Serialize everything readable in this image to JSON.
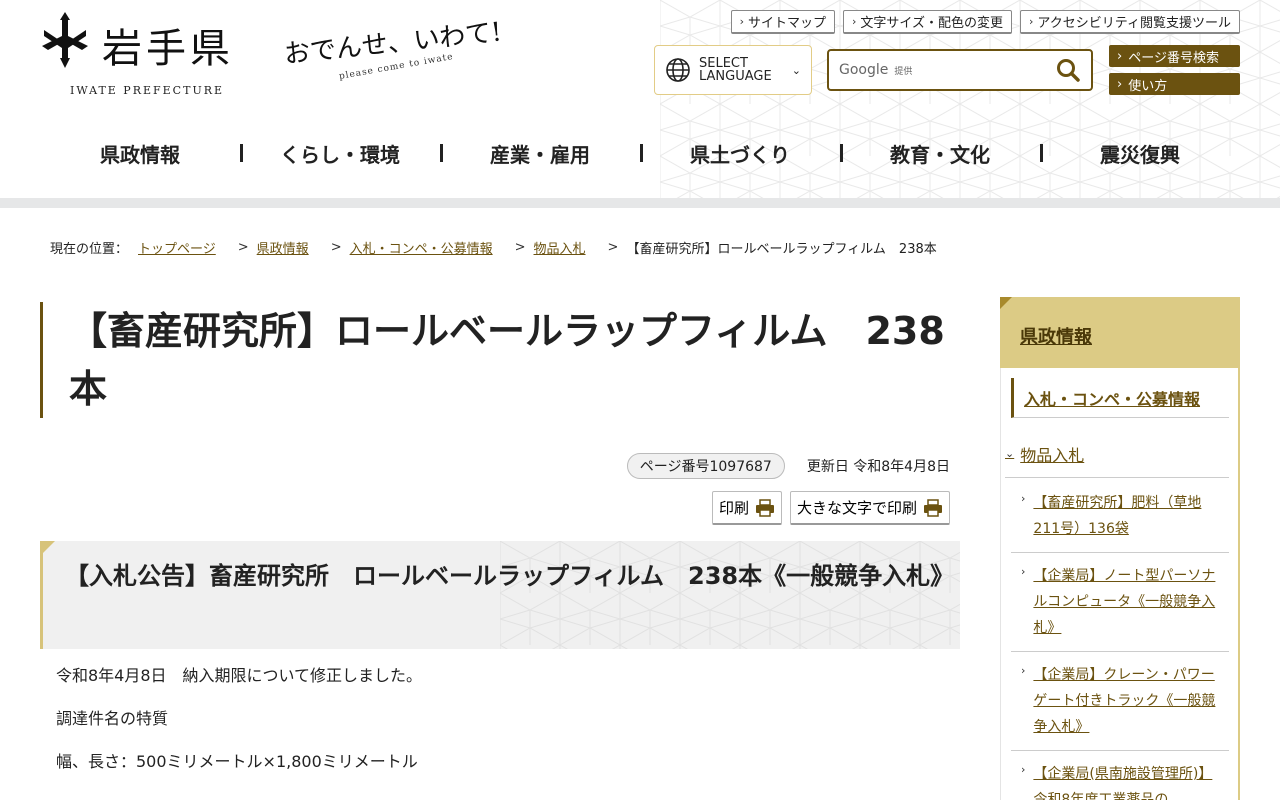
{
  "header": {
    "logo_name": "岩手県",
    "logo_sub": "IWATE PREFECTURE",
    "catch_main": "おでんせ、いわて!",
    "catch_sub": "please come to iwate",
    "util_links": [
      "サイトマップ",
      "文字サイズ・配色の変更",
      "アクセシビリティ閲覧支援ツール"
    ],
    "lang_line1": "SELECT",
    "lang_line2": "LANGUAGE",
    "search_google": "Google",
    "search_google_sub": "提供",
    "side_buttons": [
      "ページ番号検索",
      "使い方"
    ],
    "nav": [
      "県政情報",
      "くらし・環境",
      "産業・雇用",
      "県土づくり",
      "教育・文化",
      "震災復興"
    ]
  },
  "breadcrumb": {
    "label": "現在の位置：",
    "items": [
      "トップページ",
      "県政情報",
      "入札・コンペ・公募情報",
      "物品入札"
    ],
    "current": "【畜産研究所】ロールベールラップフィルム　238本"
  },
  "main": {
    "title": "【畜産研究所】ロールベールラップフィルム　238本",
    "page_number": "ページ番号1097687",
    "updated": "更新日 令和8年4月8日",
    "print_label": "印刷",
    "print_large_label": "大きな文字で印刷",
    "h2": "【入札公告】畜産研究所　ロールベールラップフィルム　238本《一般競争入札》",
    "paragraphs": [
      "令和8年4月8日　納入期限について修正しました。",
      "調達件名の特質",
      "幅、長さ：500ミリメートル×1,800ミリメートル"
    ]
  },
  "sidebar": {
    "head": "県政情報",
    "level2": "入札・コンペ・公募情報",
    "level3": "物品入札",
    "items": [
      "【畜産研究所】肥料（草地211号）136袋",
      "【企業局】ノート型パーソナルコンピュータ《一般競争入札》",
      "【企業局】クレーン・パワーゲート付きトラック《一般競争入札》",
      "【企業局(県南施設管理所)】令和8年度工業薬品の"
    ]
  },
  "colors": {
    "accent_brown": "#6b5210",
    "accent_gold": "#dccb85"
  }
}
